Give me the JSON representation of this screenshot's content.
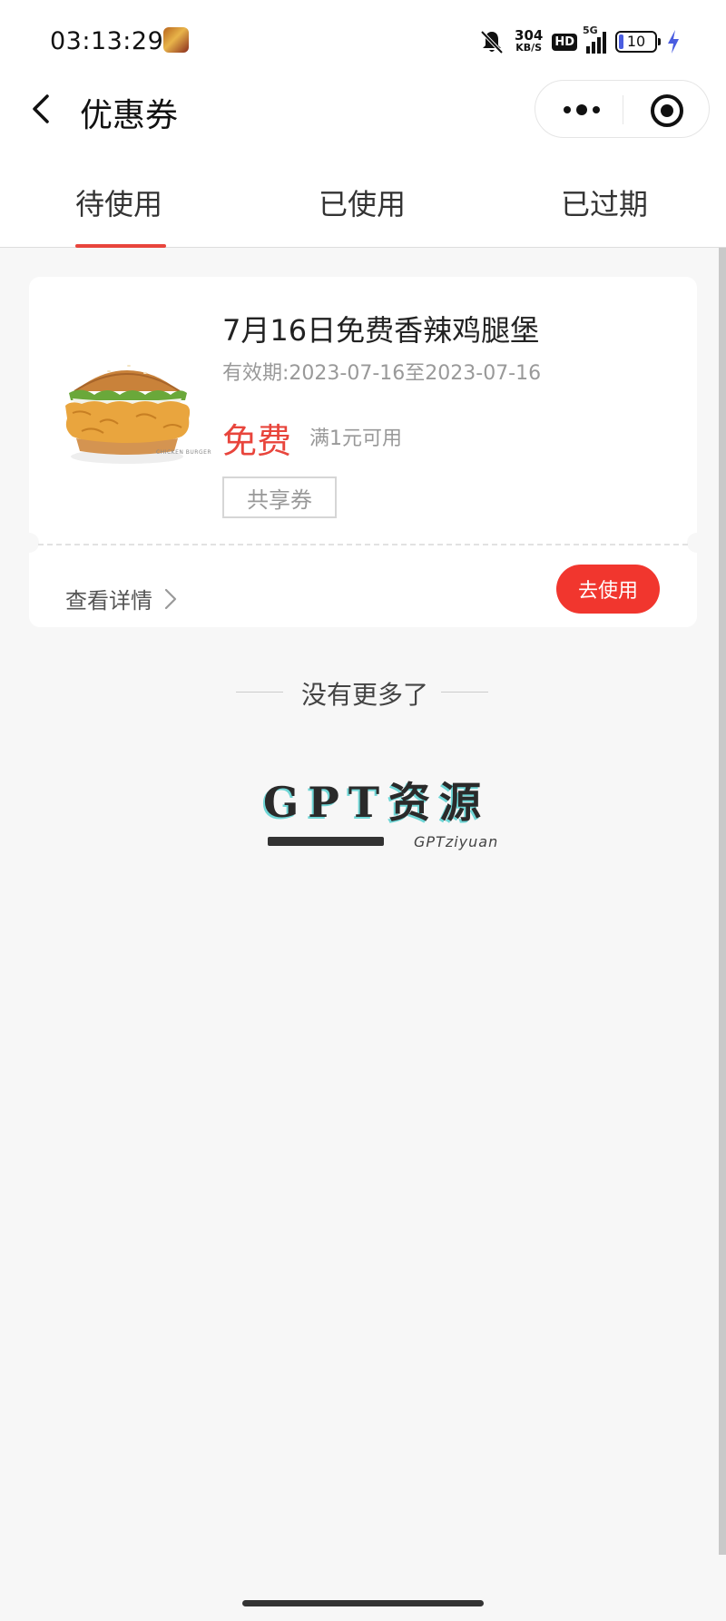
{
  "status_bar": {
    "time": "03:13:29",
    "net_speed_value": "304",
    "net_speed_unit": "KB/S",
    "hd": "HD",
    "network": "5G",
    "battery": "10"
  },
  "nav": {
    "title": "优惠券"
  },
  "tabs": [
    {
      "label": "待使用",
      "active": true
    },
    {
      "label": "已使用",
      "active": false
    },
    {
      "label": "已过期",
      "active": false
    }
  ],
  "coupon": {
    "name": "7月16日免费香辣鸡腿堡",
    "validity": "有效期:2023-07-16至2023-07-16",
    "price": "免费",
    "condition": "满1元可用",
    "tag": "共享券",
    "detail_label": "查看详情",
    "use_label": "去使用",
    "burger_caption": "CHICKEN BURGER"
  },
  "list_end": "没有更多了",
  "watermark": {
    "title": "GPT资源",
    "subtitle": "GPTziyuan"
  },
  "colors": {
    "accent": "#e8453c",
    "button": "#f1362e",
    "background": "#f7f7f7"
  }
}
